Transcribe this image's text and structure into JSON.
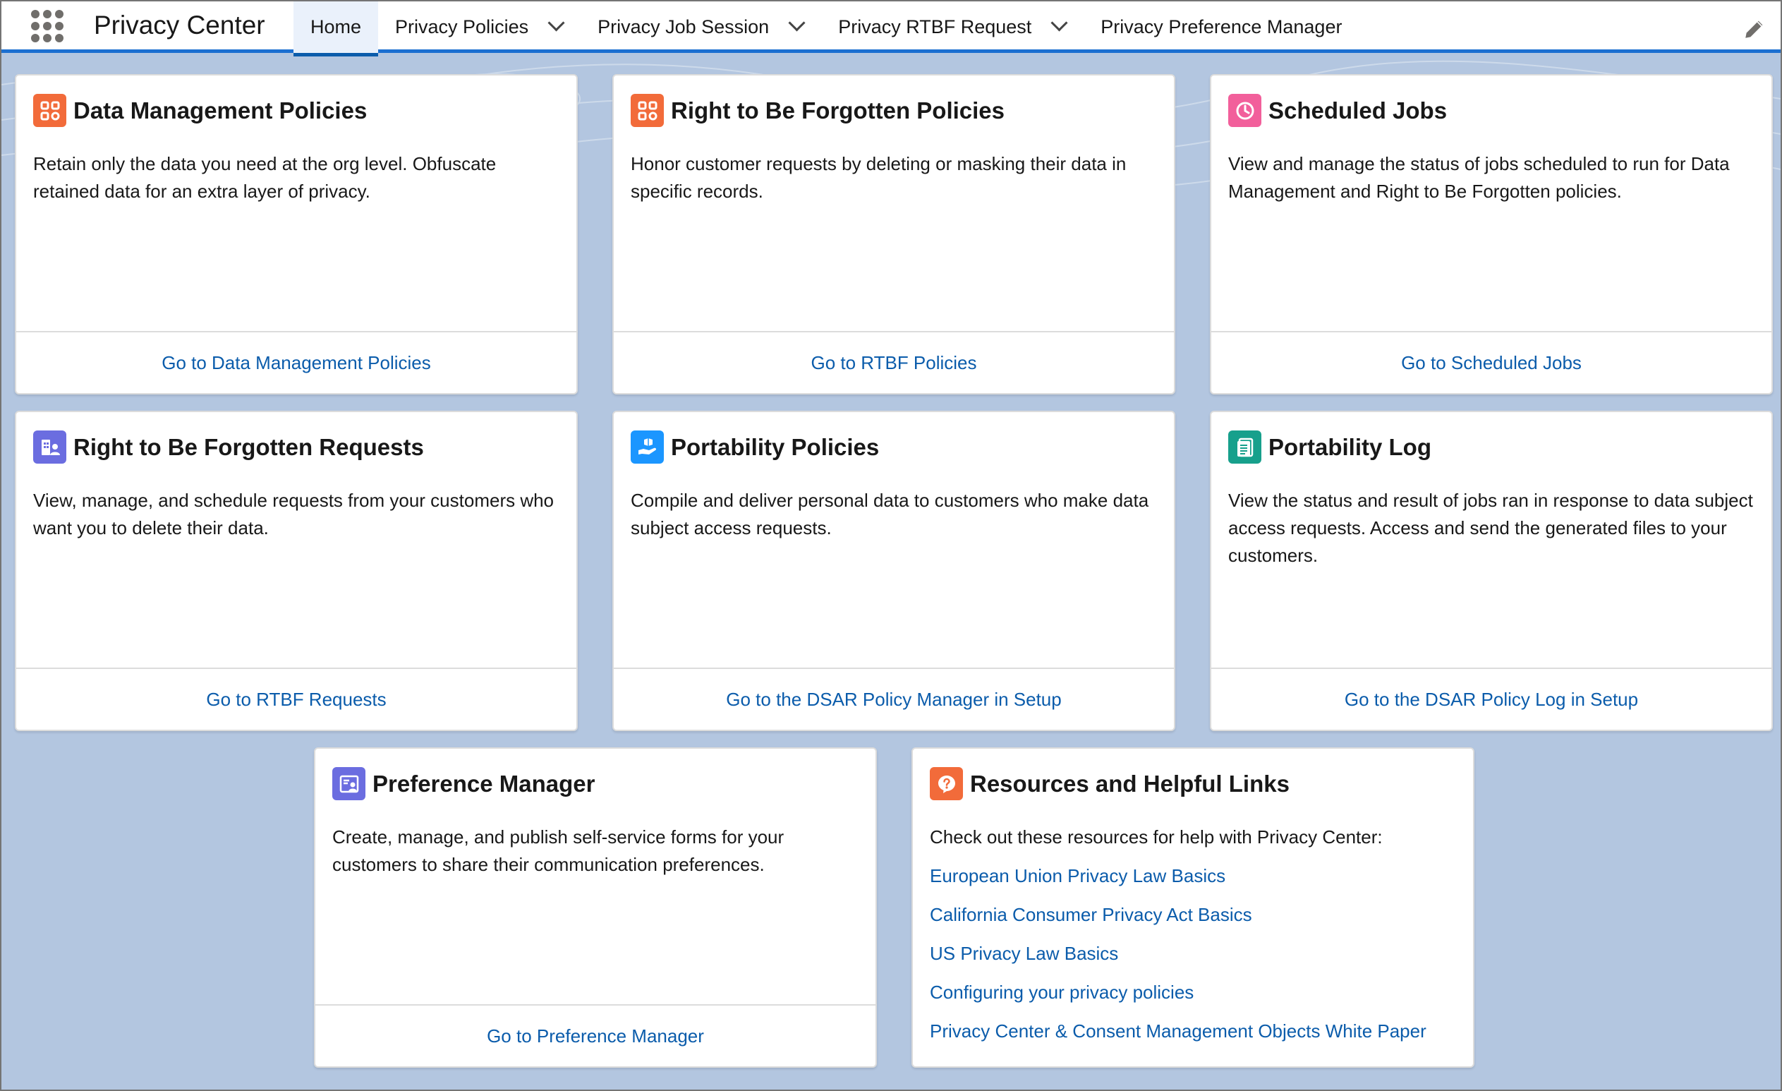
{
  "app": {
    "name": "Privacy Center",
    "brand_color": "#1b6fd1"
  },
  "nav": {
    "items": [
      {
        "label": "Home",
        "active": true,
        "has_dropdown": false
      },
      {
        "label": "Privacy Policies",
        "active": false,
        "has_dropdown": true
      },
      {
        "label": "Privacy Job Session",
        "active": false,
        "has_dropdown": true
      },
      {
        "label": "Privacy RTBF Request",
        "active": false,
        "has_dropdown": true
      },
      {
        "label": "Privacy Preference Manager",
        "active": false,
        "has_dropdown": false
      }
    ]
  },
  "cards": {
    "data_management": {
      "icon": "policy-grid-icon",
      "icon_color": "#f26b3a",
      "title": "Data Management Policies",
      "description": "Retain only the data you need at the org level. Obfuscate retained data for an extra layer of privacy.",
      "link": "Go to Data Management Policies"
    },
    "rtbf_policies": {
      "icon": "policy-grid-icon",
      "icon_color": "#f26b3a",
      "title": "Right to Be Forgotten Policies",
      "description": "Honor customer requests by deleting or masking their data in specific records.",
      "link": "Go to RTBF Policies"
    },
    "scheduled_jobs": {
      "icon": "clock-icon",
      "icon_color": "#f25f9b",
      "title": "Scheduled Jobs",
      "description": "View and manage the status of jobs scheduled to run for Data Management and Right to Be Forgotten policies.",
      "link": "Go to Scheduled Jobs"
    },
    "rtbf_requests": {
      "icon": "request-person-icon",
      "icon_color": "#6b6de0",
      "title": "Right to Be Forgotten Requests",
      "description": "View, manage, and schedule requests from your customers who want you to delete their data.",
      "link": "Go to RTBF Requests"
    },
    "portability_policies": {
      "icon": "package-hand-icon",
      "icon_color": "#1b96ff",
      "title": "Portability Policies",
      "description": "Compile and deliver personal data to customers who make data subject access requests.",
      "link": "Go to the DSAR Policy Manager in Setup"
    },
    "portability_log": {
      "icon": "log-document-icon",
      "icon_color": "#17a08c",
      "title": "Portability Log",
      "description": "View the status and result of jobs ran in response to data subject access requests. Access and send the generated files to your customers.",
      "link": "Go to the DSAR Policy Log in Setup"
    },
    "preference_manager": {
      "icon": "preference-form-icon",
      "icon_color": "#6b6de0",
      "title": "Preference Manager",
      "description": "Create, manage, and publish self-service forms for your customers to share their communication preferences.",
      "link": "Go to Preference Manager"
    },
    "resources": {
      "icon": "question-icon",
      "icon_color": "#f26b3a",
      "title": "Resources and Helpful Links",
      "intro": "Check out these resources for help with Privacy Center:",
      "links": [
        "European Union Privacy Law Basics",
        "California Consumer Privacy Act Basics",
        "US Privacy Law Basics",
        "Configuring your privacy policies",
        "Privacy Center & Consent Management Objects White Paper"
      ]
    }
  }
}
